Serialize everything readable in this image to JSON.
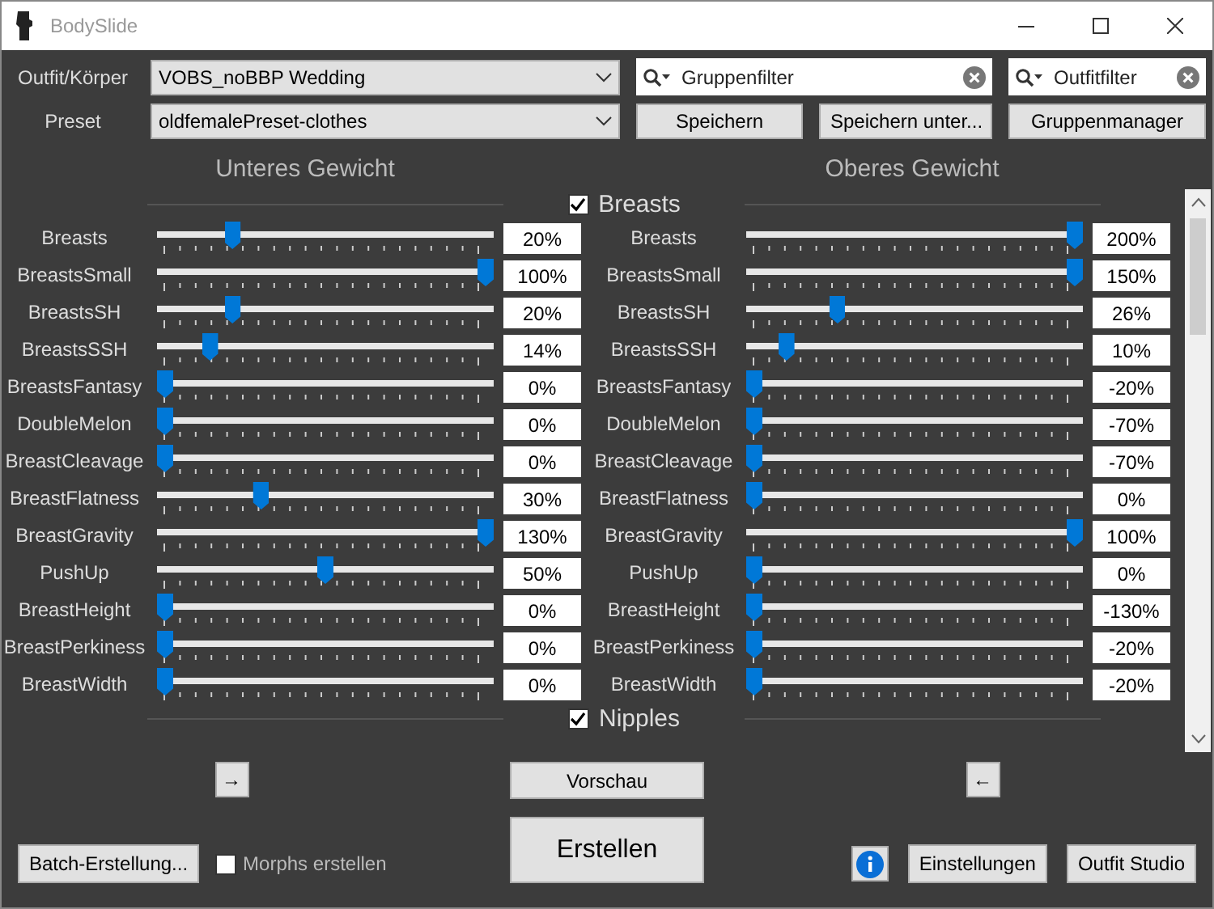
{
  "window": {
    "title": "BodySlide"
  },
  "outfit": {
    "label": "Outfit/Körper",
    "value": "VOBS_noBBP Wedding"
  },
  "group_filter": {
    "placeholder": "Gruppenfilter"
  },
  "outfit_filter": {
    "placeholder": "Outfitfilter"
  },
  "preset": {
    "label": "Preset",
    "value": "oldfemalePreset-clothes"
  },
  "preset_buttons": [
    "Speichern",
    "Speichern unter...",
    "Gruppenmanager"
  ],
  "columns": [
    "Unteres Gewicht",
    "Oberes Gewicht"
  ],
  "groups": [
    {
      "name": "Breasts",
      "checked": true,
      "sliders": [
        {
          "low": {
            "name": "Breasts",
            "level": 0.21,
            "value": "20%"
          },
          "high": {
            "name": "Breasts",
            "level": 1,
            "value": "200%"
          }
        },
        {
          "low": {
            "name": "BreastsSmall",
            "level": 1,
            "value": "100%"
          },
          "high": {
            "name": "BreastsSmall",
            "level": 1,
            "value": "150%"
          }
        },
        {
          "low": {
            "name": "BreastsSH",
            "level": 0.21,
            "value": "20%"
          },
          "high": {
            "name": "BreastsSH",
            "level": 0.26,
            "value": "26%"
          }
        },
        {
          "low": {
            "name": "BreastsSSH",
            "level": 0.14,
            "value": "14%"
          },
          "high": {
            "name": "BreastsSSH",
            "level": 0.1,
            "value": "10%"
          }
        },
        {
          "low": {
            "name": "BreastsFantasy",
            "level": 0,
            "value": "0%"
          },
          "high": {
            "name": "BreastsFantasy",
            "level": 0,
            "value": "-20%"
          }
        },
        {
          "low": {
            "name": "DoubleMelon",
            "level": 0,
            "value": "0%"
          },
          "high": {
            "name": "DoubleMelon",
            "level": 0,
            "value": "-70%"
          }
        },
        {
          "low": {
            "name": "BreastCleavage",
            "level": 0,
            "value": "0%"
          },
          "high": {
            "name": "BreastCleavage",
            "level": 0,
            "value": "-70%"
          }
        },
        {
          "low": {
            "name": "BreastFlatness",
            "level": 0.3,
            "value": "30%"
          },
          "high": {
            "name": "BreastFlatness",
            "level": 0,
            "value": "0%"
          }
        },
        {
          "low": {
            "name": "BreastGravity",
            "level": 1,
            "value": "130%"
          },
          "high": {
            "name": "BreastGravity",
            "level": 1,
            "value": "100%"
          }
        },
        {
          "low": {
            "name": "PushUp",
            "level": 0.5,
            "value": "50%"
          },
          "high": {
            "name": "PushUp",
            "level": 0,
            "value": "0%"
          }
        },
        {
          "low": {
            "name": "BreastHeight",
            "level": 0,
            "value": "0%"
          },
          "high": {
            "name": "BreastHeight",
            "level": 0,
            "value": "-130%"
          }
        },
        {
          "low": {
            "name": "BreastPerkiness",
            "level": 0,
            "value": "0%"
          },
          "high": {
            "name": "BreastPerkiness",
            "level": 0,
            "value": "-20%"
          }
        },
        {
          "low": {
            "name": "BreastWidth",
            "level": 0,
            "value": "0%"
          },
          "high": {
            "name": "BreastWidth",
            "level": 0,
            "value": "-20%"
          }
        }
      ]
    },
    {
      "name": "Nipples",
      "checked": true
    }
  ],
  "copy_low_button": "→",
  "preview_button": "Vorschau",
  "copy_high_button": "←",
  "build_button": "Erstellen",
  "batch_button": "Batch-Erstellung...",
  "morphs": {
    "label": "Morphs erstellen",
    "checked": false
  },
  "settings_button": "Einstellungen",
  "outfit_studio_button": "Outfit Studio"
}
